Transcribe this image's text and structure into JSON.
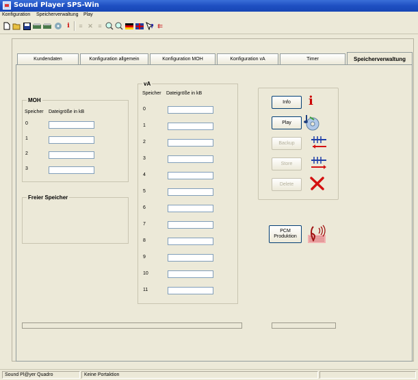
{
  "window": {
    "title": "Sound Player SPS-Win"
  },
  "menu": [
    "Konfiguration",
    "Speicherverwaltung",
    "Play"
  ],
  "tabs": [
    "Kundendaten",
    "Konfiguration allgemein",
    "Konfiguration MOH",
    "Konfiguration vA",
    "Timer",
    "Speicherverwaltung"
  ],
  "active_tab": "Speicherverwaltung",
  "moh": {
    "title": "MOH",
    "col_speicher": "Speicher",
    "col_size": "Dateigröße in kB",
    "rows": [
      "0",
      "1",
      "2",
      "3"
    ]
  },
  "va": {
    "title": "vA",
    "col_speicher": "Speicher",
    "col_size": "Dateigröße in kB",
    "rows": [
      "0",
      "1",
      "2",
      "3",
      "4",
      "5",
      "6",
      "7",
      "8",
      "9",
      "10",
      "11"
    ]
  },
  "freier_speicher": {
    "title": "Freier Speicher"
  },
  "buttons": {
    "info": "Info",
    "play": "Play",
    "backup": "Backup",
    "store": "Store",
    "delete": "Delete",
    "pcm": "PCM Produktion"
  },
  "status": {
    "device": "Sound Pl@yer Quadro",
    "action": "Keine Portaktion"
  },
  "colors": {
    "titlebar": "#1e4fc2",
    "face": "#ece9d8",
    "info_icon": "#cc0000",
    "arrow_blue": "#1e3fa8",
    "delete_red": "#d41010"
  }
}
